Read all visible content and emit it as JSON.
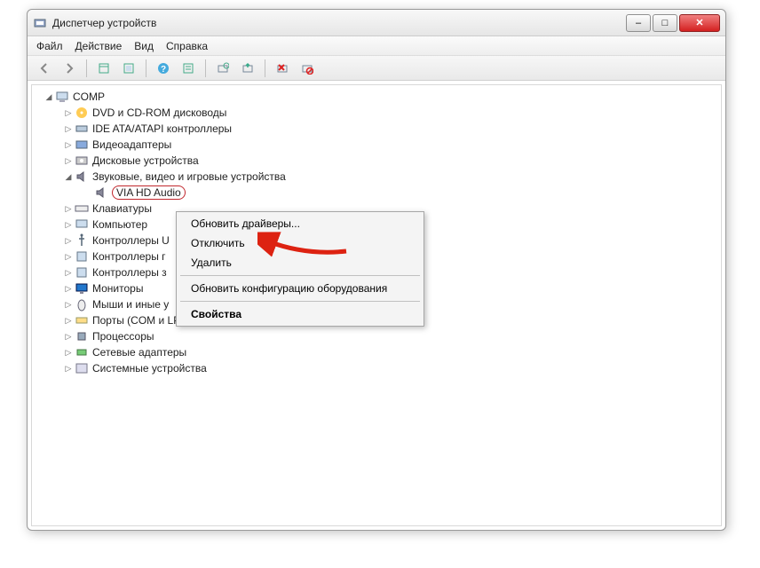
{
  "window": {
    "title": "Диспетчер устройств"
  },
  "menu": {
    "file": "Файл",
    "action": "Действие",
    "view": "Вид",
    "help": "Справка"
  },
  "winbtns": {
    "min": "–",
    "max": "□",
    "close": "✕"
  },
  "tree": {
    "root": "COMP",
    "items": [
      {
        "label": "DVD и CD-ROM дисководы"
      },
      {
        "label": "IDE ATA/ATAPI контроллеры"
      },
      {
        "label": "Видеоадаптеры"
      },
      {
        "label": "Дисковые устройства"
      },
      {
        "label": "Звуковые, видео и игровые устройства",
        "expanded": true,
        "children": [
          {
            "label": "VIA HD Audio",
            "selected": true
          }
        ]
      },
      {
        "label": "Клавиатуры"
      },
      {
        "label": "Компьютер"
      },
      {
        "label": "Контроллеры U"
      },
      {
        "label": "Контроллеры г"
      },
      {
        "label": "Контроллеры з"
      },
      {
        "label": "Мониторы"
      },
      {
        "label": "Мыши и иные у"
      },
      {
        "label": "Порты (COM и LPT)"
      },
      {
        "label": "Процессоры"
      },
      {
        "label": "Сетевые адаптеры"
      },
      {
        "label": "Системные устройства"
      }
    ]
  },
  "context_menu": {
    "update": "Обновить драйверы...",
    "disable": "Отключить",
    "delete": "Удалить",
    "rescan": "Обновить конфигурацию оборудования",
    "props": "Свойства"
  },
  "toolbar": {
    "back": "back",
    "fwd": "forward",
    "view1": "list-view",
    "view2": "detail-view",
    "help": "help",
    "props": "properties",
    "scan": "scan",
    "refresh": "refresh",
    "disable": "disable",
    "uninstall": "uninstall"
  }
}
